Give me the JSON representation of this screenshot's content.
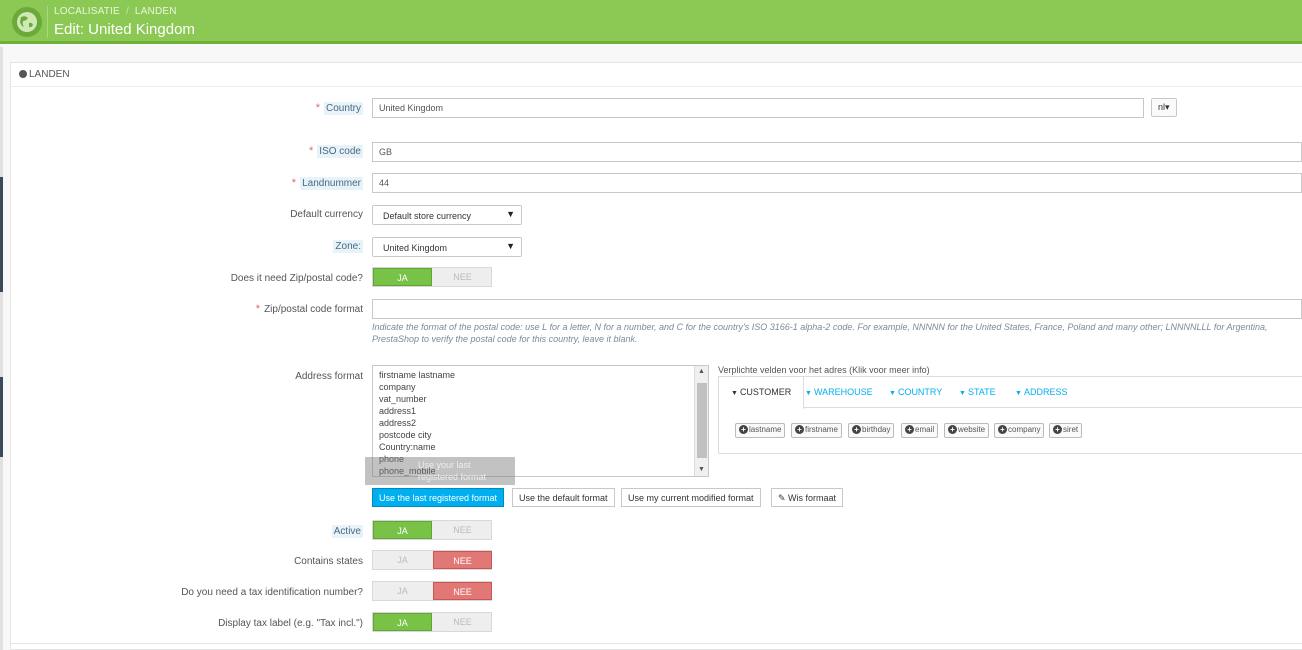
{
  "header": {
    "breadcrumb": [
      "LOCALISATIE",
      "LANDEN"
    ],
    "breadcrumb_sep": "/",
    "title": "Edit: United Kingdom",
    "colors": {
      "bar": "#8bc954",
      "accent": "#6fb03b"
    }
  },
  "panel": {
    "heading": "LANDEN",
    "heading_icon": "globe-icon"
  },
  "form": {
    "country": {
      "label": "Country",
      "required": "*",
      "value": "United Kingdom",
      "lang": "nl"
    },
    "iso": {
      "label": "ISO code",
      "required": "*",
      "value": "GB"
    },
    "landnummer": {
      "label": "Landnummer",
      "required": "*",
      "value": "44"
    },
    "currency": {
      "label": "Default currency",
      "value": "Default store currency"
    },
    "zone": {
      "label": "Zone:",
      "value": "United Kingdom"
    },
    "zip_needed": {
      "label": "Does it need Zip/postal code?",
      "yes": "JA",
      "no": "NEE",
      "selected": "JA"
    },
    "zip_format": {
      "label": "Zip/postal code format",
      "required": "*",
      "value": "",
      "help_line1": "Indicate the format of the postal code: use L for a letter, N for a number, and C for the country's ISO 3166-1 alpha-2 code. For example, NNNNN for the United States, France, Poland and many other; LNNNNLLL for Argentina,",
      "help_line2": "PrestaShop to verify the postal code for this country, leave it blank."
    },
    "address_format": {
      "label": "Address format",
      "lines": [
        "firstname lastname",
        "company",
        "vat_number",
        "address1",
        "address2",
        "postcode city",
        "Country:name",
        "phone",
        "phone_mobile"
      ],
      "tooltip_line1": "Use your last",
      "tooltip_line2": "registered format",
      "buttons": {
        "last": "Use the last registered format",
        "default": "Use the default format",
        "current": "Use my current modified format",
        "clear": "Wis formaat"
      },
      "fields_title": "Verplichte velden voor het adres (Klik voor meer info)",
      "tabs": [
        "CUSTOMER",
        "WAREHOUSE",
        "COUNTRY",
        "STATE",
        "ADDRESS"
      ],
      "chips": [
        "lastname",
        "firstname",
        "birthday",
        "email",
        "website",
        "company",
        "siret"
      ]
    },
    "active": {
      "label": "Active",
      "yes": "JA",
      "no": "NEE",
      "selected": "JA"
    },
    "contains_states": {
      "label": "Contains states",
      "yes": "JA",
      "no": "NEE",
      "selected": "NEE"
    },
    "tax_id": {
      "label": "Do you need a tax identification number?",
      "yes": "JA",
      "no": "NEE",
      "selected": "NEE"
    },
    "tax_label": {
      "label": "Display tax label (e.g. \"Tax incl.\")",
      "yes": "JA",
      "no": "NEE",
      "selected": "JA"
    }
  }
}
